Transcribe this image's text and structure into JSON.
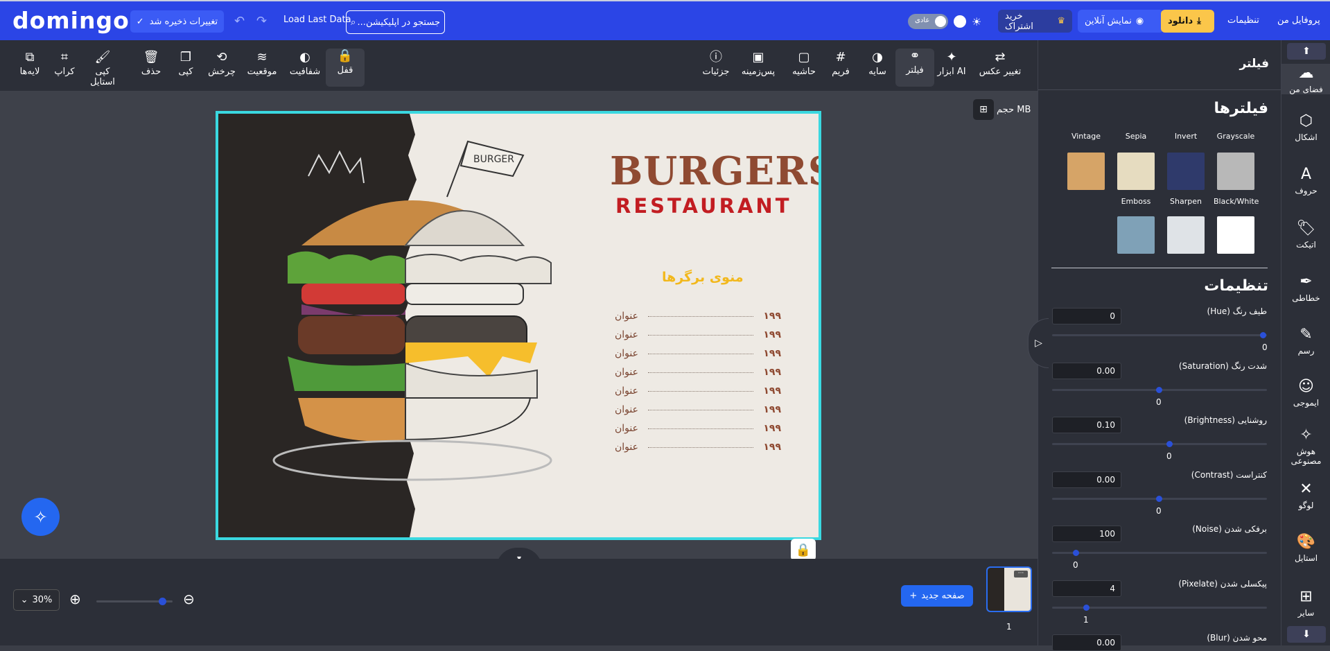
{
  "app": {
    "logo": "domingo"
  },
  "header": {
    "saved_label": "تغییرات ذخیره شد",
    "load_last": "Load Last Data",
    "search_placeholder": "جستجو در اپلیکیشن...",
    "mode_label": "عادی",
    "subscribe_label": "خرید اشتراک",
    "preview_label": "نمایش آنلاین",
    "download_label": "دانلود",
    "settings_label": "تنظیمات",
    "profile_label": "پروفایل من"
  },
  "toolbar": {
    "left_tools": [
      {
        "label": "لایه‌ها",
        "icon": "layers-icon",
        "glyph": "⧉"
      },
      {
        "label": "کراپ",
        "icon": "crop-icon",
        "glyph": "⌗"
      },
      {
        "label": "کپی استایل",
        "icon": "paint-brush-icon",
        "glyph": "🖌"
      },
      {
        "label": "حذف",
        "icon": "trash-icon",
        "glyph": "🗑"
      },
      {
        "label": "کپی",
        "icon": "copy-icon",
        "glyph": "❐"
      },
      {
        "label": "چرخش",
        "icon": "rotate-icon",
        "glyph": "⟲"
      },
      {
        "label": "موقعیت",
        "icon": "stack-icon",
        "glyph": "≋"
      },
      {
        "label": "شفافیت",
        "icon": "opacity-icon",
        "glyph": "◐"
      },
      {
        "label": "قفل",
        "icon": "lock-icon",
        "glyph": "🔒"
      }
    ],
    "right_tools": [
      {
        "label": "جزئیات",
        "icon": "info-icon",
        "glyph": "ⓘ"
      },
      {
        "label": "پس‌زمینه",
        "icon": "background-icon",
        "glyph": "▣"
      },
      {
        "label": "حاشیه",
        "icon": "border-icon",
        "glyph": "▢"
      },
      {
        "label": "فریم",
        "icon": "frame-icon",
        "glyph": "#"
      },
      {
        "label": "سایه",
        "icon": "shadow-icon",
        "glyph": "◑"
      },
      {
        "label": "فیلتر",
        "icon": "filter-icon",
        "glyph": "⚭"
      },
      {
        "label": "ابزار AI",
        "icon": "ai-icon",
        "glyph": "✦"
      },
      {
        "label": "تغییر عکس",
        "icon": "replace-image-icon",
        "glyph": "⇄"
      }
    ]
  },
  "canvas": {
    "size_label": "حجم MB",
    "design": {
      "title": "BURGERS",
      "subtitle": "RESTAURANT",
      "flag_text": "BURGER",
      "menu_title": "منوی برگرها",
      "menu_items": [
        {
          "name": "عنوان",
          "price": "۱۹۹"
        },
        {
          "name": "عنوان",
          "price": "۱۹۹"
        },
        {
          "name": "عنوان",
          "price": "۱۹۹"
        },
        {
          "name": "عنوان",
          "price": "۱۹۹"
        },
        {
          "name": "عنوان",
          "price": "۱۹۹"
        },
        {
          "name": "عنوان",
          "price": "۱۹۹"
        },
        {
          "name": "عنوان",
          "price": "۱۹۹"
        },
        {
          "name": "عنوان",
          "price": "۱۹۹"
        }
      ]
    }
  },
  "bottom": {
    "zoom": "30%",
    "zoom_level": 0.9,
    "new_page": "صفحه جدید",
    "page_number": "1",
    "thumb_menu": "···"
  },
  "panel": {
    "title": "فیلتر",
    "filters_title": "فیلترها",
    "filters_row1": [
      {
        "name": "Grayscale",
        "color": "#b8b8b8"
      },
      {
        "name": "Invert",
        "color": "#2f3a6b"
      },
      {
        "name": "Sepia",
        "color": "#e6dcc0"
      },
      {
        "name": "Vintage",
        "color": "#d6a467"
      }
    ],
    "filters_row2": [
      {
        "name": "Black/White",
        "color": "#ffffff"
      },
      {
        "name": "Sharpen",
        "color": "#dfe3e7"
      },
      {
        "name": "Emboss",
        "color": "#7fa1b7"
      }
    ],
    "settings_title": "تنظیمات",
    "settings": [
      {
        "label": "طیف رنگ (Hue)",
        "value": "0",
        "slider_value": "0",
        "level": 1.0
      },
      {
        "label": "شدت رنگ (Saturation)",
        "value": "0.00",
        "slider_value": "0",
        "level": 0.5
      },
      {
        "label": "روشنایی (Brightness)",
        "value": "0.10",
        "slider_value": "0",
        "level": 0.55
      },
      {
        "label": "کنتراست (Contrast)",
        "value": "0.00",
        "slider_value": "0",
        "level": 0.5
      },
      {
        "label": "برفکی شدن (Noise)",
        "value": "100",
        "slider_value": "0",
        "level": 0.1
      },
      {
        "label": "پیکسلی شدن (Pixelate)",
        "value": "4",
        "slider_value": "1",
        "level": 0.15
      },
      {
        "label": "محو شدن (Blur)",
        "value": "0.00"
      }
    ]
  },
  "nav": {
    "items": [
      {
        "label": "فضای من",
        "icon": "cloud-upload-icon",
        "glyph": "☁"
      },
      {
        "label": "اشکال",
        "icon": "shapes-icon",
        "glyph": "⬡"
      },
      {
        "label": "حروف",
        "icon": "text-icon",
        "glyph": "A"
      },
      {
        "label": "اتیکت",
        "icon": "tag-icon",
        "glyph": "🏷"
      },
      {
        "label": "خطاطی",
        "icon": "feather-icon",
        "glyph": "✒"
      },
      {
        "label": "رسم",
        "icon": "pencil-icon",
        "glyph": "✎"
      },
      {
        "label": "ایموجی",
        "icon": "emoji-icon",
        "glyph": "☺"
      },
      {
        "label": "هوش مصنوعی",
        "icon": "magic-wand-icon",
        "glyph": "✧"
      },
      {
        "label": "لوگو",
        "icon": "logo-shapes-icon",
        "glyph": "✕"
      },
      {
        "label": "استایل",
        "icon": "palette-icon",
        "glyph": "🎨"
      },
      {
        "label": "سایر",
        "icon": "grid-plus-icon",
        "glyph": "⊞"
      }
    ]
  }
}
